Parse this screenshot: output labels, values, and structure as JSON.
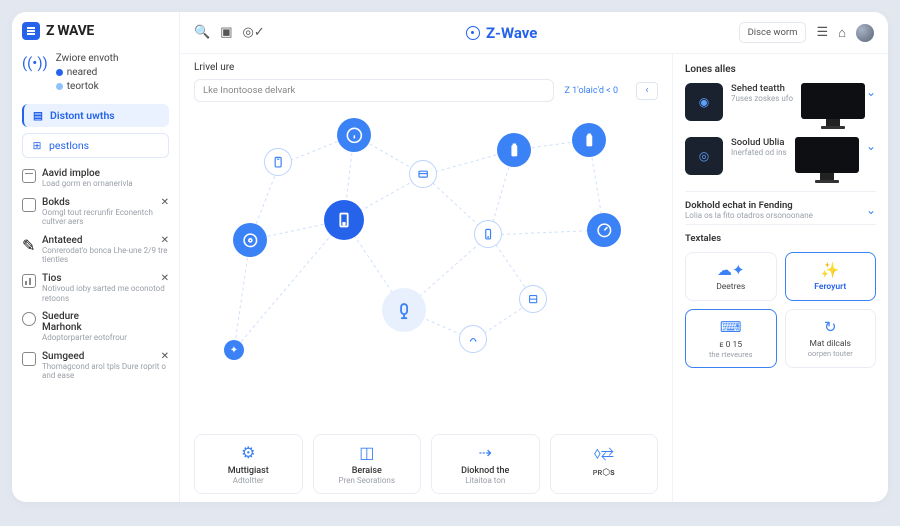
{
  "brand": {
    "logo_text": "Z WAVE",
    "center_text": "Z-Wave"
  },
  "topbar": {
    "action_button": "Disce worm"
  },
  "sidebar": {
    "network": {
      "title": "Zwiore envoth",
      "line1": "neared",
      "line2": "teortok"
    },
    "nav_active": "Distont uwths",
    "nav_soft": "pestlons",
    "cats": [
      {
        "title": "Aavid imploe",
        "sub": "Load gorm en ornanerivla",
        "closable": false
      },
      {
        "title": "Bokds",
        "sub": "Oomgl tout recrunfir\nEconentch cultver aers",
        "closable": true
      },
      {
        "title": "Antateed",
        "sub": "Conrerodat'o bonca\nLhe-une 2/9 tre tientles",
        "closable": true
      },
      {
        "title": "Tios",
        "sub": "Notivoud ioby sarted\nme oconotod retoons",
        "closable": true
      },
      {
        "title": "Suedure\nMarhonk",
        "sub": "Adoptorparter eotofrour",
        "closable": false
      },
      {
        "title": "Sumgeed",
        "sub": "Thomagcond arol tpls\nDure roprit o and ease",
        "closable": true
      }
    ]
  },
  "main": {
    "section_title": "Lrivel ure",
    "search_placeholder": "Lke Inontoose delvark",
    "stat_text": "Z 1'olaic'd < 0",
    "bottom": [
      {
        "title": "Muttigiast",
        "sub": "Adtoltter"
      },
      {
        "title": "Beraise",
        "sub": "Pren Seorations"
      },
      {
        "title": "Dioknod the",
        "sub": "Litaitoa ton"
      },
      {
        "title": "ᴘʀ⬡s",
        "sub": ""
      }
    ]
  },
  "right": {
    "title": "Lones alles",
    "devices": [
      {
        "name": "Sehed teatth",
        "sub": "7uses zoskes ufo"
      },
      {
        "name": "Soolud Ublia",
        "sub": "Inerfated od ins"
      }
    ],
    "section2_title": "Dokhold echat in Fending",
    "section2_sub": "Lolia os la fito otadros orsonoonane",
    "section3_title": "Textales",
    "cards": [
      {
        "title": "Deetres",
        "sub": ""
      },
      {
        "title": "Feroyurt",
        "sub": ""
      },
      {
        "title": "ᴇ 0 15",
        "sub": "the rteveures"
      },
      {
        "title": "Mat dilcals",
        "sub": "oorpen touter"
      }
    ]
  }
}
